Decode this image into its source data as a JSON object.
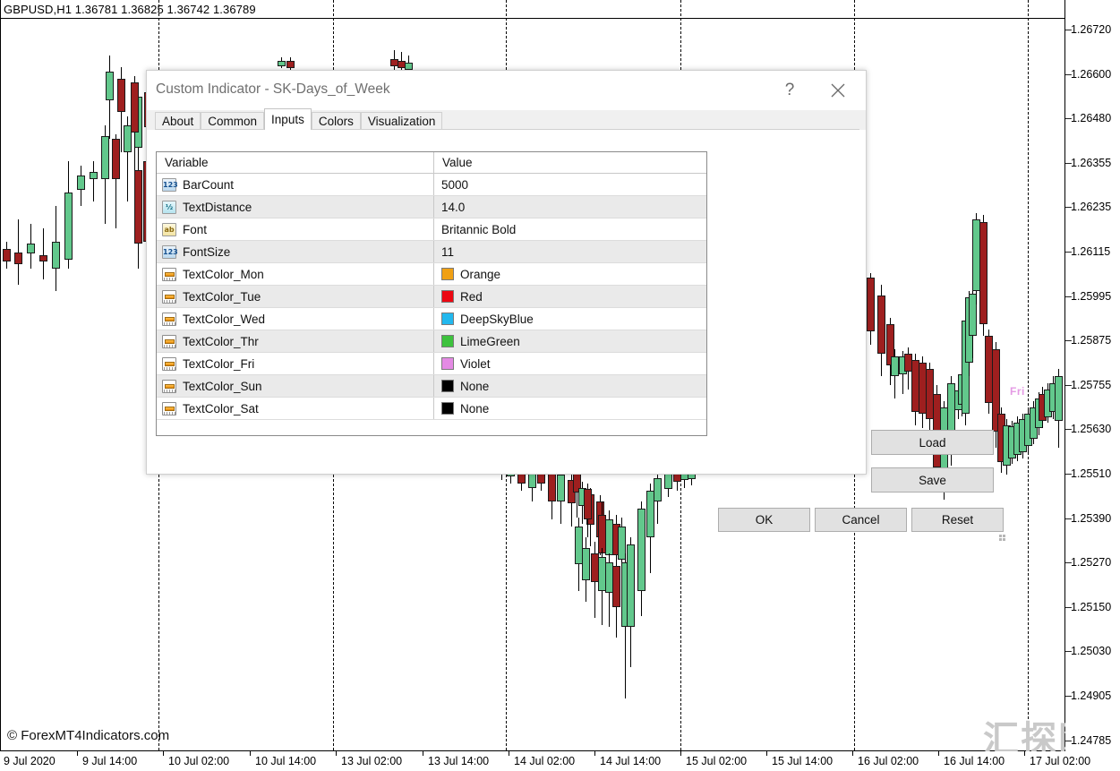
{
  "chart": {
    "quote_bar": "GBPUSD,H1  1.36781 1.36825 1.36742 1.36789",
    "symbol": "GBPUSD",
    "timeframe": "H1",
    "ohlc": {
      "open": "1.36781",
      "high": "1.36825",
      "low": "1.36742",
      "close": "1.36789"
    },
    "copyright": "© ForexMT4Indicators.com",
    "watermark": "汇探网",
    "day_label": {
      "text": "Fri",
      "color": "#e49ae4"
    },
    "candle_colors": {
      "up": "#62c88c",
      "down": "#9e1f1f",
      "outline": "#1a1a1a"
    },
    "price_scale": {
      "ticks": [
        "1.26720",
        "1.26600",
        "1.26480",
        "1.26355",
        "1.26235",
        "1.26115",
        "1.25995",
        "1.25875",
        "1.25755",
        "1.25630",
        "1.25510",
        "1.25390",
        "1.25270",
        "1.25150",
        "1.25030",
        "1.24905",
        "1.24785"
      ]
    },
    "time_scale": {
      "ticks": [
        "9 Jul 2020",
        "9 Jul 14:00",
        "10 Jul 02:00",
        "10 Jul 14:00",
        "13 Jul 02:00",
        "13 Jul 14:00",
        "14 Jul 02:00",
        "14 Jul 14:00",
        "15 Jul 02:00",
        "15 Jul 14:00",
        "16 Jul 02:00",
        "16 Jul 14:00",
        "17 Jul 02:00"
      ]
    }
  },
  "dialog": {
    "title": "Custom Indicator - SK-Days_of_Week",
    "help_label": "?",
    "close_label": "Close",
    "tabs": [
      {
        "label": "About",
        "active": false
      },
      {
        "label": "Common",
        "active": false
      },
      {
        "label": "Inputs",
        "active": true
      },
      {
        "label": "Colors",
        "active": false
      },
      {
        "label": "Visualization",
        "active": false
      }
    ],
    "table": {
      "headers": {
        "variable": "Variable",
        "value": "Value"
      },
      "rows": [
        {
          "icon": "int",
          "variable": "BarCount",
          "value": "5000",
          "swatch": null
        },
        {
          "icon": "dbl",
          "variable": "TextDistance",
          "value": "14.0",
          "swatch": null
        },
        {
          "icon": "str",
          "variable": "Font",
          "value": "Britannic Bold",
          "swatch": null
        },
        {
          "icon": "int",
          "variable": "FontSize",
          "value": "11",
          "swatch": null
        },
        {
          "icon": "color",
          "variable": "TextColor_Mon",
          "value": "Orange",
          "swatch": "#f0a014"
        },
        {
          "icon": "color",
          "variable": "TextColor_Tue",
          "value": "Red",
          "swatch": "#ec0712"
        },
        {
          "icon": "color",
          "variable": "TextColor_Wed",
          "value": "DeepSkyBlue",
          "swatch": "#22b8ee"
        },
        {
          "icon": "color",
          "variable": "TextColor_Thr",
          "value": "LimeGreen",
          "swatch": "#3dc23d"
        },
        {
          "icon": "color",
          "variable": "TextColor_Fri",
          "value": "Violet",
          "swatch": "#e48ae4"
        },
        {
          "icon": "color",
          "variable": "TextColor_Sun",
          "value": "None",
          "swatch": "#000000"
        },
        {
          "icon": "color",
          "variable": "TextColor_Sat",
          "value": "None",
          "swatch": "#000000"
        }
      ]
    },
    "buttons": {
      "load": "Load",
      "save": "Save",
      "ok": "OK",
      "cancel": "Cancel",
      "reset": "Reset"
    }
  }
}
